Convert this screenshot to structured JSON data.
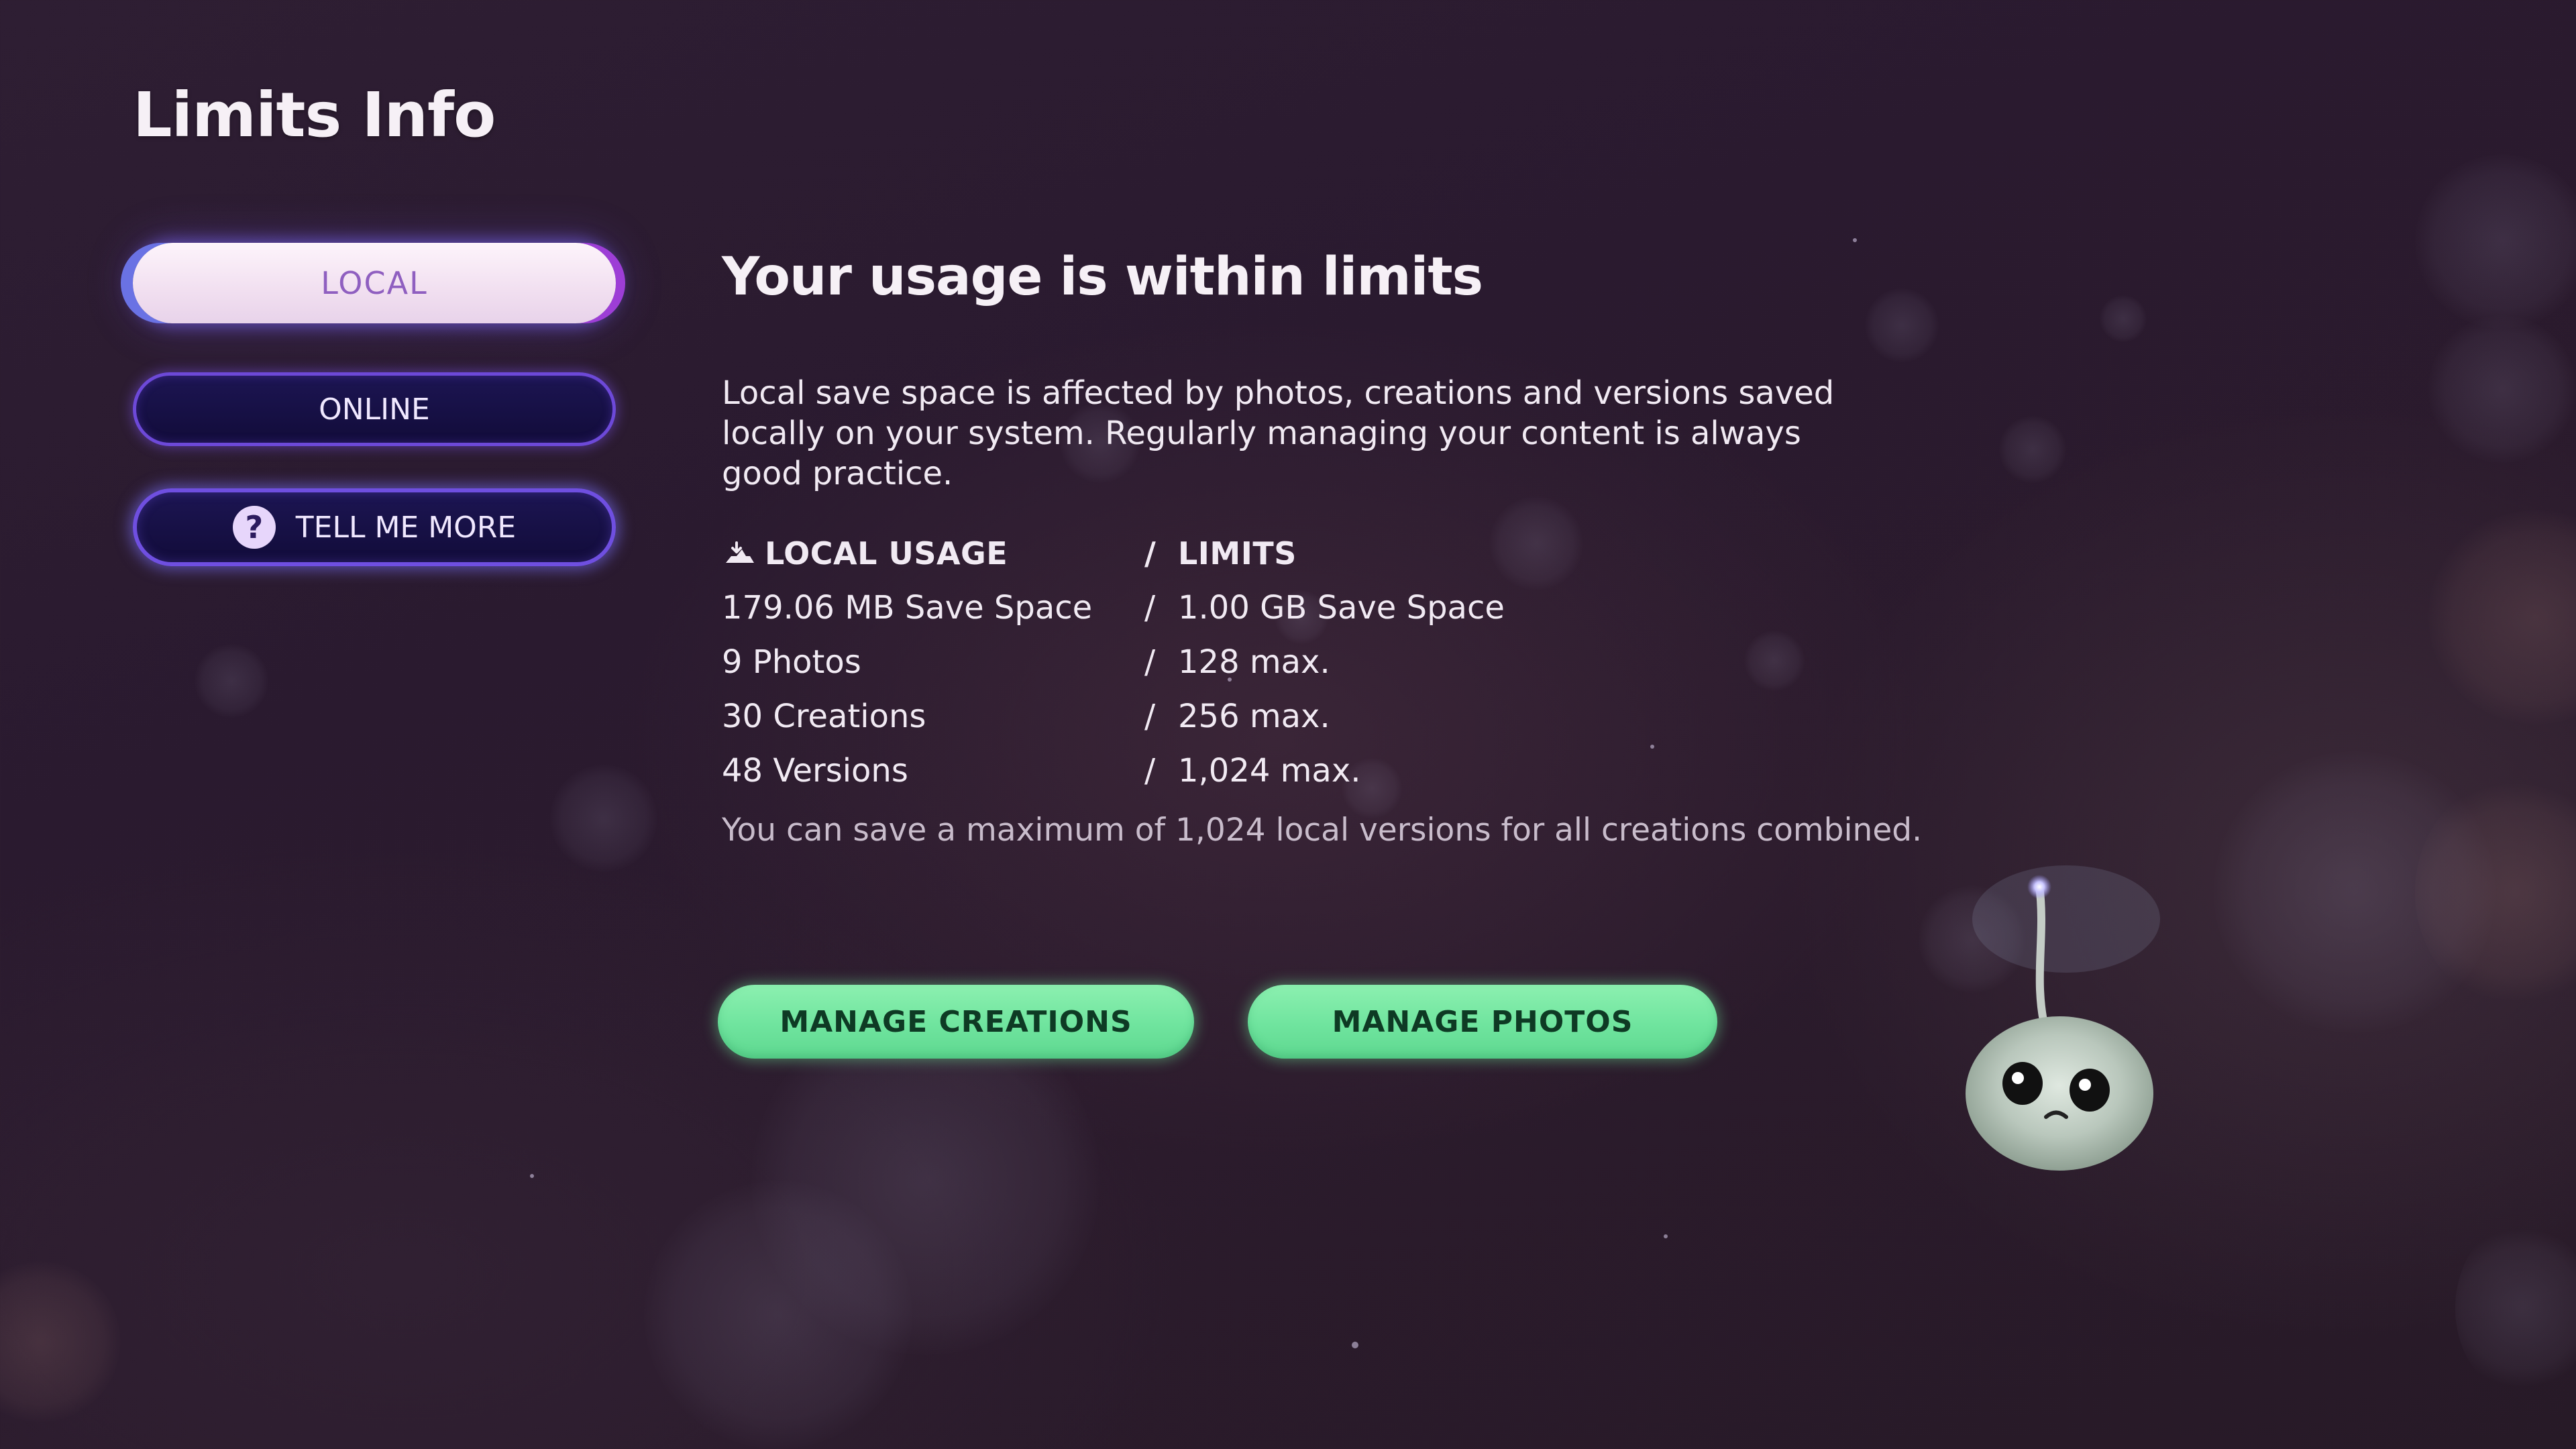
{
  "page_title": "Limits Info",
  "tabs": {
    "local": "LOCAL",
    "online": "ONLINE",
    "tell_me_more": "TELL ME MORE"
  },
  "main": {
    "headline": "Your usage is within limits",
    "description": "Local save space is affected by photos, creations and versions saved locally on your system. Regularly managing your content is always good practice.",
    "header": {
      "usage_label": "LOCAL USAGE",
      "limits_label": "LIMITS"
    },
    "rows": [
      {
        "usage": "179.06 MB Save Space",
        "limit": "1.00 GB Save Space"
      },
      {
        "usage": "9 Photos",
        "limit": "128 max."
      },
      {
        "usage": "30 Creations",
        "limit": "256 max."
      },
      {
        "usage": "48 Versions",
        "limit": "1,024 max."
      }
    ],
    "note": "You can save a maximum of 1,024 local versions for all creations combined.",
    "separator": "/"
  },
  "actions": {
    "manage_creations": "MANAGE CREATIONS",
    "manage_photos": "MANAGE PHOTOS"
  },
  "icons": {
    "help": "?",
    "usage_icon": "cloud-save-icon"
  },
  "colors": {
    "background": "#2c1c30",
    "tab_active": "#f3e3f2",
    "tab_active_text": "#8f5fc0",
    "tab_inactive": "#160f45",
    "tab_border": "#6d49d8",
    "action_button": "#74e6a2",
    "action_text": "#0e3a24"
  }
}
